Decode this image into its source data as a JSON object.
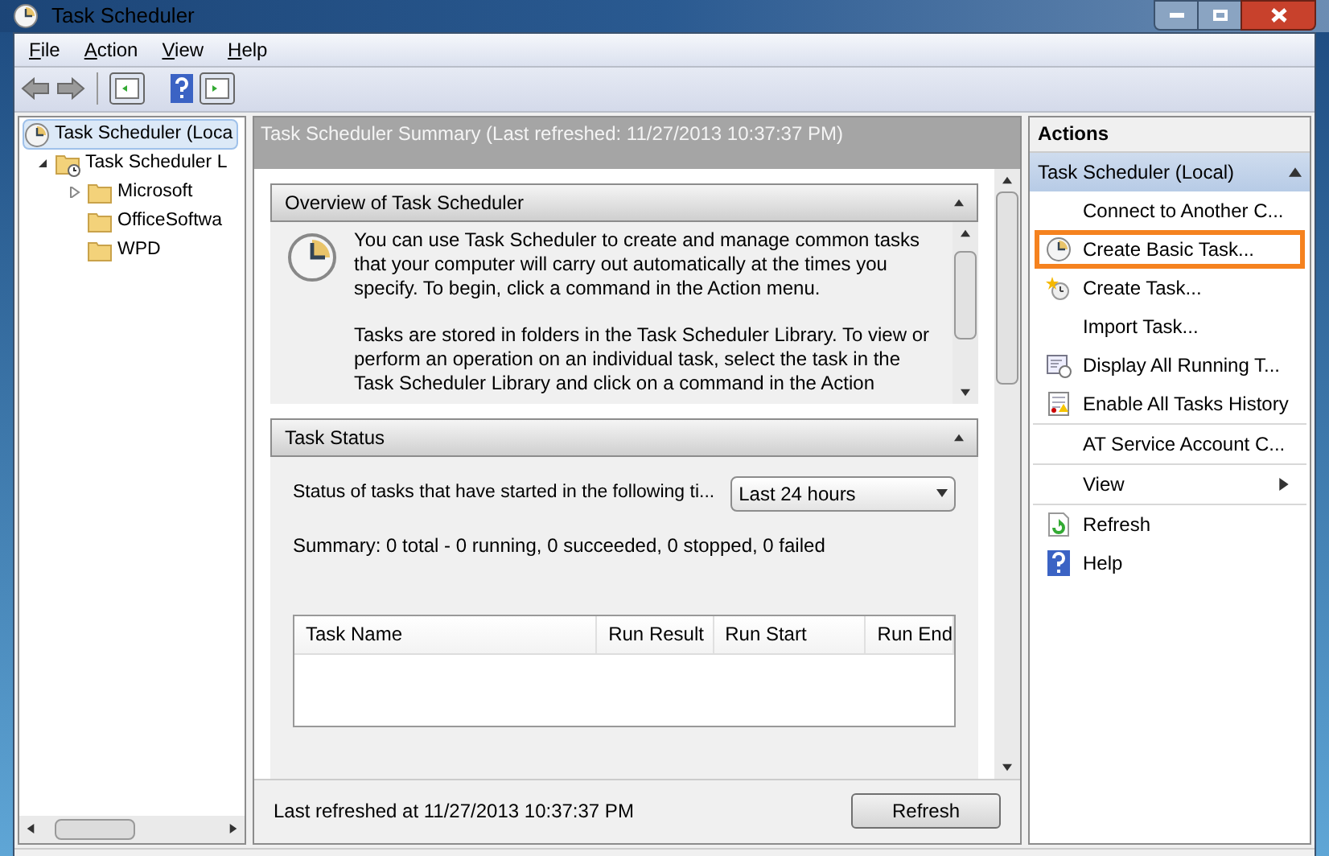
{
  "window": {
    "title": "Task Scheduler"
  },
  "menu": [
    {
      "label": "File"
    },
    {
      "label": "Action"
    },
    {
      "label": "View"
    },
    {
      "label": "Help"
    }
  ],
  "tree": [
    {
      "label": "Task Scheduler (Loca",
      "selected": true,
      "kind": "root",
      "children": [
        {
          "label": "Task Scheduler L",
          "selected": false,
          "kind": "library",
          "expanded": true,
          "children": [
            {
              "label": "Microsoft",
              "selected": false,
              "kind": "folder",
              "expanded": false
            },
            {
              "label": "OfficeSoftwa",
              "selected": false,
              "kind": "folder"
            },
            {
              "label": "WPD",
              "selected": false,
              "kind": "folder"
            }
          ]
        }
      ]
    }
  ],
  "summary_header": "Task Scheduler Summary (Last refreshed: 11/27/2013 10:37:37 PM)",
  "overview": {
    "title": "Overview of Task Scheduler",
    "expanded": true,
    "paragraphs": [
      "You can use Task Scheduler to create and manage common tasks that your computer will carry out automatically at the times you specify. To begin, click a command in the Action menu.",
      "Tasks are stored in folders in the Task Scheduler Library. To view or perform an operation on an individual task, select the task in the Task Scheduler Library and click on a command in the Action"
    ]
  },
  "task_status": {
    "title": "Task Status",
    "expanded": true,
    "filter_label": "Status of tasks that have started in the following ti...",
    "filter_value": "Last 24 hours",
    "summary": "Summary: 0 total - 0 running, 0 succeeded, 0 stopped, 0 failed",
    "columns": [
      "Task Name",
      "Run Result",
      "Run Start",
      "Run End"
    ]
  },
  "footer": {
    "last_refreshed": "Last refreshed at 11/27/2013 10:37:37 PM",
    "button": "Refresh"
  },
  "actions": {
    "title": "Actions",
    "group": {
      "title": "Task Scheduler (Local)",
      "expanded": true
    },
    "sections": [
      {
        "items": [
          {
            "label": "Connect to Another C...",
            "kind": "plain",
            "highlighted": false,
            "submenu": false
          },
          {
            "label": "Create Basic Task...",
            "kind": "basic",
            "highlighted": true,
            "submenu": false
          },
          {
            "label": "Create Task...",
            "kind": "task",
            "highlighted": false,
            "submenu": false
          },
          {
            "label": "Import Task...",
            "kind": "plain",
            "highlighted": false,
            "submenu": false
          },
          {
            "label": "Display All Running T...",
            "kind": "running",
            "highlighted": false,
            "submenu": false
          },
          {
            "label": "Enable All Tasks History",
            "kind": "history",
            "highlighted": false,
            "submenu": false
          }
        ]
      },
      {
        "items": [
          {
            "label": "AT Service Account C...",
            "kind": "plain",
            "highlighted": false,
            "submenu": false
          }
        ]
      },
      {
        "items": [
          {
            "label": "View",
            "kind": "plain",
            "highlighted": false,
            "submenu": true
          }
        ]
      },
      {
        "items": [
          {
            "label": "Refresh",
            "kind": "refresh",
            "highlighted": false,
            "submenu": false
          },
          {
            "label": "Help",
            "kind": "help",
            "highlighted": false,
            "submenu": false
          }
        ]
      }
    ]
  }
}
